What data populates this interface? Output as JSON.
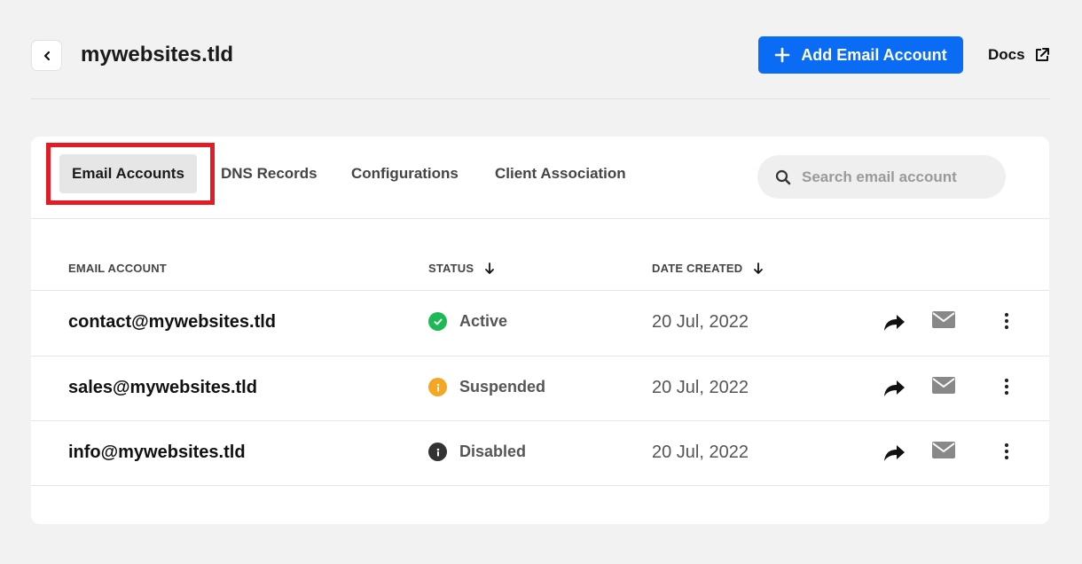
{
  "header": {
    "title": "mywebsites.tld",
    "add_button_label": "Add Email Account",
    "docs_label": "Docs"
  },
  "tabs": [
    {
      "label": "Email Accounts",
      "active": true
    },
    {
      "label": "DNS Records",
      "active": false
    },
    {
      "label": "Configurations",
      "active": false
    },
    {
      "label": "Client Association",
      "active": false
    }
  ],
  "search": {
    "placeholder": "Search email account",
    "value": ""
  },
  "table": {
    "columns": [
      "EMAIL ACCOUNT",
      "STATUS",
      "DATE CREATED"
    ],
    "rows": [
      {
        "email": "contact@mywebsites.tld",
        "status": "Active",
        "status_icon": "check-circle-icon",
        "date": "20 Jul, 2022"
      },
      {
        "email": "sales@mywebsites.tld",
        "status": "Suspended",
        "status_icon": "info-circle-icon",
        "date": "20 Jul, 2022"
      },
      {
        "email": "info@mywebsites.tld",
        "status": "Disabled",
        "status_icon": "info-circle-icon",
        "date": "20 Jul, 2022"
      }
    ]
  },
  "colors": {
    "primary": "#0a6cf5",
    "active": "#1db954",
    "suspended": "#f5a623",
    "disabled": "#333333",
    "highlight": "#e31b23"
  }
}
